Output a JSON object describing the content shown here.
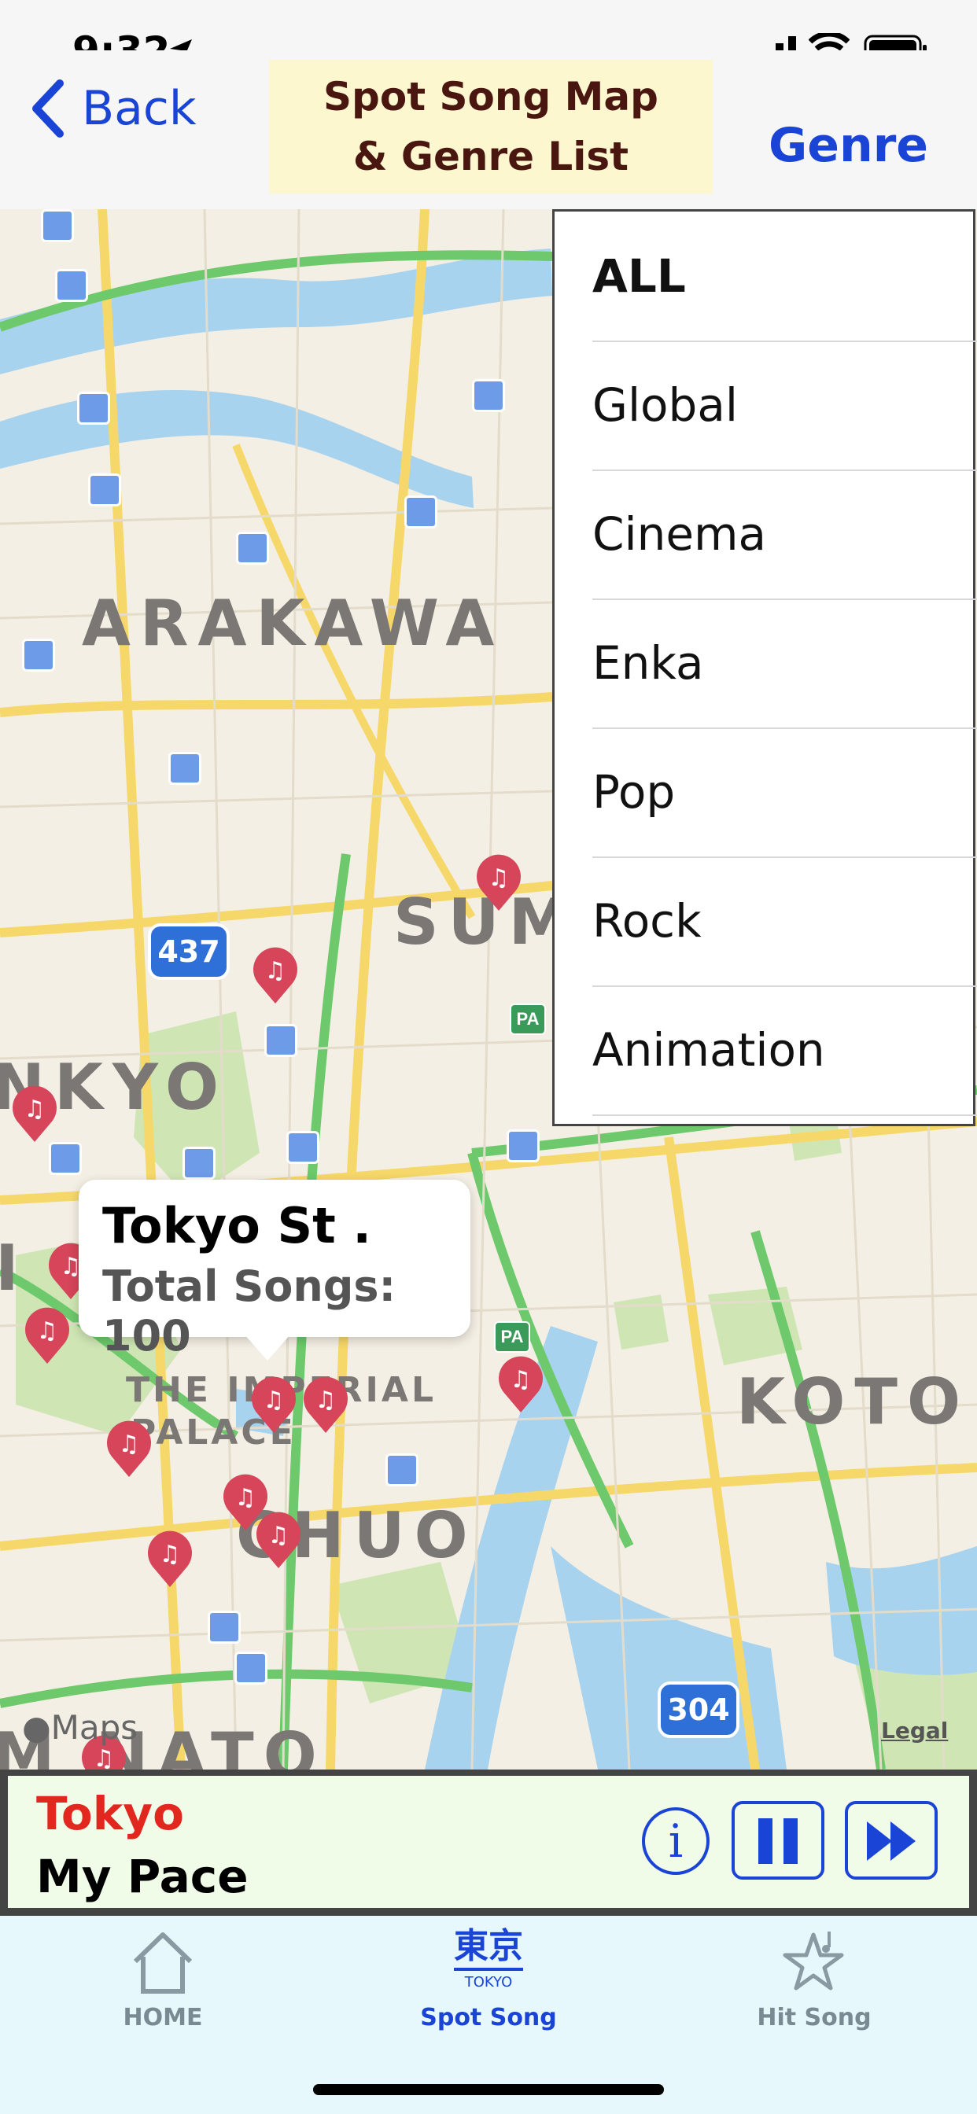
{
  "status_bar": {
    "time": "9:32"
  },
  "nav": {
    "back_label": "Back",
    "title_line1": "Spot Song Map",
    "title_line2": "& Genre List",
    "genre_label": "Genre"
  },
  "map": {
    "labels": [
      "ARAKAWA",
      "SUM",
      "NKYO",
      "KOTO",
      "CHUO",
      "THE IMPERIAL",
      "PALACE",
      "M NATO",
      "I"
    ],
    "road_shields": [
      "437",
      "304"
    ],
    "attribution": "Maps",
    "legal": "Legal",
    "pa_sign": "PA",
    "callout": {
      "title": "Tokyo St .",
      "subtitle": "Total Songs: 100"
    }
  },
  "genre_menu": {
    "items": [
      "ALL",
      "Global",
      "Cinema",
      "Enka",
      "Pop",
      "Rock",
      "Animation"
    ]
  },
  "player": {
    "title": "Tokyo",
    "song": "My Pace",
    "info_icon": "info-icon",
    "pause_icon": "pause-icon",
    "next_icon": "fast-forward-icon"
  },
  "tabs": [
    {
      "label": "HOME",
      "icon": "house-icon"
    },
    {
      "label": "Spot Song",
      "icon_text": "東京",
      "icon_sub": "TOKYO"
    },
    {
      "label": "Hit Song",
      "icon": "star-note-icon"
    }
  ],
  "colors": {
    "accent": "#1a44d6",
    "pin": "#d6455a",
    "title_bg": "#fdf7cf",
    "player_title": "#e2281e",
    "tab_inactive": "#7a8a92"
  }
}
